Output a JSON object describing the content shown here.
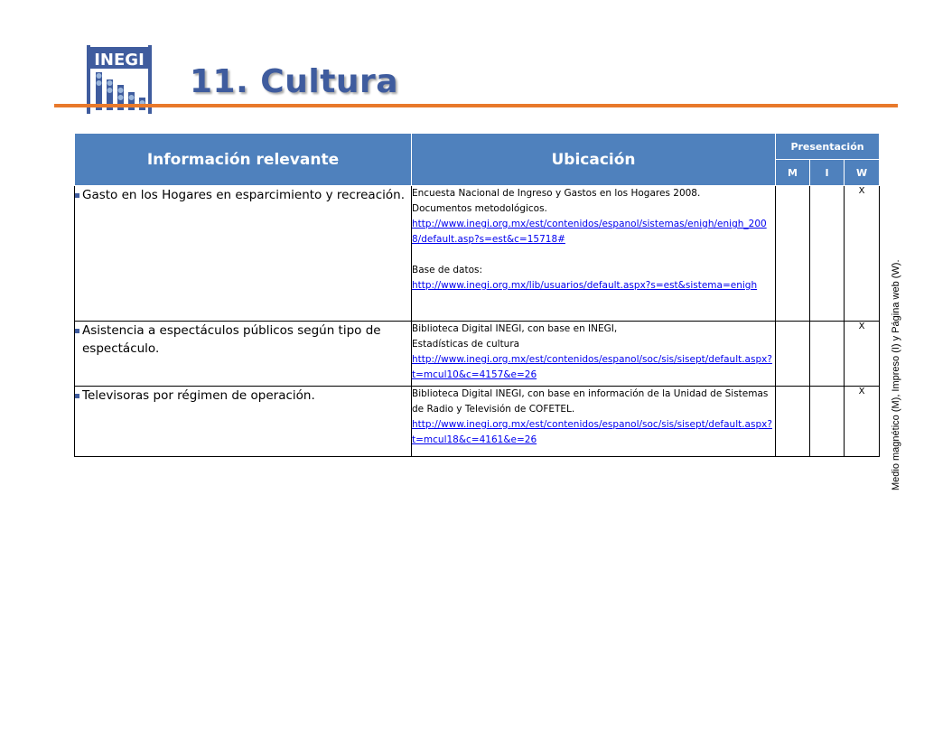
{
  "header": {
    "logo_text": "INEGI",
    "title": "11. Cultura"
  },
  "side_note": "Medio magnético (M), Impreso (I)  y Página web (W).",
  "table": {
    "headers": {
      "info": "Información  relevante",
      "location": "Ubicación",
      "presentation": "Presentación",
      "m": "M",
      "i": "I",
      "w": "W"
    },
    "rows": [
      {
        "info": "Gasto en los Hogares en esparcimiento y recreación.",
        "loc_line1": "Encuesta Nacional de Ingreso  y Gastos en los Hogares  2008.",
        "loc_line2": "Documentos metodológicos.",
        "loc_link1": "http://www.inegi.org.mx/est/contenidos/espanol/sistemas/enigh/enigh_2008/default.asp?s=est&c=15718#",
        "loc_line3": "Base de datos:",
        "loc_link2": "http://www.inegi.org.mx/lib/usuarios/default.aspx?s=est&sistema=enigh",
        "m": "",
        "i": "",
        "w": "X"
      },
      {
        "info": "Asistencia a espectáculos públicos según tipo de espectáculo.",
        "loc_line1": "Biblioteca Digital INEGI, con base  en INEGI,",
        "loc_line2": "Estadísticas de cultura",
        "loc_link1": "http://www.inegi.org.mx/est/contenidos/espanol/soc/sis/sisept/default.aspx?t=mcul10&c=4157&e=26",
        "m": "",
        "i": "",
        "w": "X"
      },
      {
        "info": "Televisoras por régimen de operación.",
        "loc_line1": "Biblioteca Digital INEGI, con base en información de la Unidad de Sistemas de Radio y Televisión de COFETEL.",
        "loc_link1": "http://www.inegi.org.mx/est/contenidos/espanol/soc/sis/sisept/default.aspx?t=mcul18&c=4161&e=26",
        "m": "",
        "i": "",
        "w": "X"
      }
    ]
  },
  "colors": {
    "header_blue": "#4F81BD",
    "accent_orange": "#E8792B",
    "title_blue": "#3F5C9E"
  }
}
